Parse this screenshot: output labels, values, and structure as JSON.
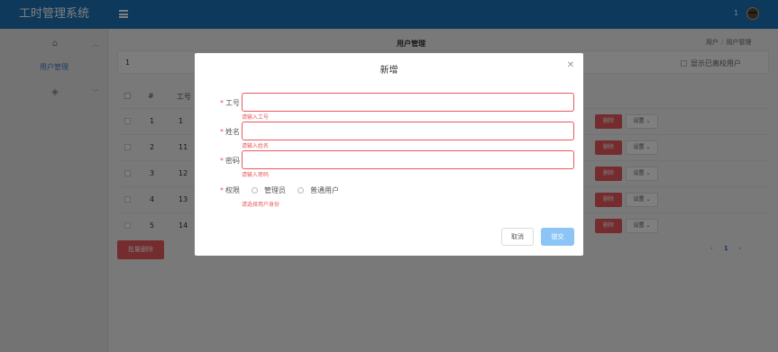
{
  "app": {
    "title": "工时管理系统"
  },
  "header": {
    "user_number": "1"
  },
  "sidebar": {
    "groups": [
      {
        "icon": "home-icon",
        "expanded": true,
        "items": [
          {
            "label": "用户管理"
          }
        ]
      },
      {
        "icon": "graduation-cap-icon",
        "expanded": false
      }
    ]
  },
  "main": {
    "page_title": "用户管理",
    "breadcrumb": [
      "用户",
      "用户管理"
    ],
    "filter": {
      "value": "1",
      "show_resigned_label": "显示已离校用户"
    },
    "table": {
      "headers": {
        "index": "#",
        "id": "工号"
      },
      "rows": [
        {
          "index": "1",
          "id": "1"
        },
        {
          "index": "2",
          "id": "11"
        },
        {
          "index": "3",
          "id": "12"
        },
        {
          "index": "4",
          "id": "13"
        },
        {
          "index": "5",
          "id": "14"
        }
      ],
      "delete_label": "删除",
      "settings_label": "设置"
    },
    "batch_delete_label": "批量删除",
    "pager": {
      "current_page": "1"
    }
  },
  "modal": {
    "title": "新增",
    "fields": {
      "employee_id": {
        "label": "工号",
        "value": "",
        "error": "请输入工号"
      },
      "name": {
        "label": "姓名",
        "value": "",
        "error": "请输入姓名"
      },
      "password": {
        "label": "密码",
        "value": "",
        "error": "请输入密码"
      }
    },
    "role": {
      "label": "权限",
      "options": [
        "管理员",
        "普通用户"
      ],
      "error": "请选择用户身份"
    },
    "cancel_label": "取消",
    "submit_label": "提交"
  },
  "colors": {
    "header_blue": "#1a73b8",
    "danger_red": "#e8585c",
    "submit_blue": "#8cc5f5",
    "link_blue": "#3a7fd0"
  }
}
